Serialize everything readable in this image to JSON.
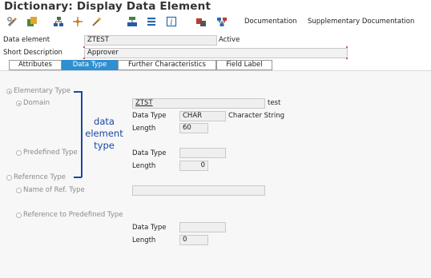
{
  "window": {
    "title": "Dictionary: Display Data Element"
  },
  "toolbar": {
    "icons": [
      "change-display-icon",
      "other-object-icon",
      "hierarchy-icon",
      "where-used-icon",
      "magic-wand-icon",
      "activate-icon",
      "object-list-icon",
      "info-icon",
      "transport-icon",
      "network-icon"
    ],
    "documentation_label": "Documentation",
    "supplementary_documentation_label": "Supplementary Documentation"
  },
  "header": {
    "data_element_label": "Data element",
    "data_element_value": "ZTEST",
    "status": "Active",
    "short_description_label": "Short Description",
    "short_description_value": "Approver"
  },
  "tabs": [
    {
      "label": "Attributes",
      "active": false
    },
    {
      "label": "Data Type",
      "active": true
    },
    {
      "label": "Further Characteristics",
      "active": false
    },
    {
      "label": "Field Label",
      "active": false
    }
  ],
  "data_type_tab": {
    "elementary_type_label": "Elementary Type",
    "domain_label": "Domain",
    "domain_value": "ZTST",
    "domain_description": "test",
    "domain_data_type_label": "Data Type",
    "domain_data_type_value": "CHAR",
    "domain_data_type_description": "Character String",
    "domain_length_label": "Length",
    "domain_length_value": "60",
    "predefined_type_label": "Predefined Type",
    "predefined_data_type_label": "Data Type",
    "predefined_data_type_value": "",
    "predefined_length_label": "Length",
    "predefined_length_value": "0",
    "reference_type_label": "Reference Type",
    "name_of_ref_type_label": "Name of Ref. Type",
    "name_of_ref_type_value": "",
    "ref_predefined_type_label": "Reference to Predefined Type",
    "ref_data_type_label": "Data Type",
    "ref_data_type_value": "",
    "ref_length_label": "Length",
    "ref_length_value": "0"
  },
  "annotation": {
    "line1": "data",
    "line2": "element",
    "line3": "type",
    "color": "#1a47a6"
  },
  "colors": {
    "active_tab": "#2e8fd1",
    "annotation": "#1a47a6"
  }
}
